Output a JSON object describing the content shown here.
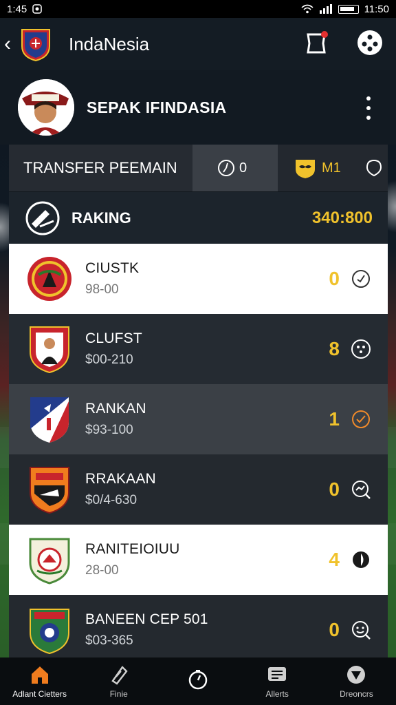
{
  "status_bar": {
    "time_left": "1:45",
    "time_right": "11:50"
  },
  "app_bar": {
    "title": "IndaNesia"
  },
  "profile": {
    "name": "SEPAK IFINDASIA"
  },
  "tabs": {
    "transfer_label": "TRANSFER PEEMAIN",
    "time_value": "0",
    "m_label": "M1"
  },
  "ranking": {
    "title": "RAKING",
    "score": "340:800"
  },
  "rows": [
    {
      "name": "CIUSTK",
      "price": "98-00",
      "count": "0",
      "action_icon": "clock-icon"
    },
    {
      "name": "CLUFST",
      "price": "$00-210",
      "count": "8",
      "action_icon": "dots-icon"
    },
    {
      "name": "RANKAN",
      "price": "$93-100",
      "count": "1",
      "action_icon": "check-badge-icon"
    },
    {
      "name": "RRAKAAN",
      "price": "$0/4-630",
      "count": "0",
      "action_icon": "search-icon"
    },
    {
      "name": "RANITEIOIUU",
      "price": "28-00",
      "count": "4",
      "action_icon": "half-circle-icon"
    },
    {
      "name": "BANEEN CEP 501",
      "price": "$03-365",
      "count": "0",
      "action_icon": "smile-icon"
    }
  ],
  "bottom_nav": [
    {
      "label": "Adlant Cietters",
      "icon": "home-icon"
    },
    {
      "label": "Finie",
      "icon": "tag-icon"
    },
    {
      "label": "",
      "icon": "timer-icon"
    },
    {
      "label": "Allerts",
      "icon": "list-icon"
    },
    {
      "label": "Dreoncrs",
      "icon": "shield-icon"
    }
  ],
  "colors": {
    "accent": "#f0c22c",
    "home_active": "#f07c1e"
  }
}
